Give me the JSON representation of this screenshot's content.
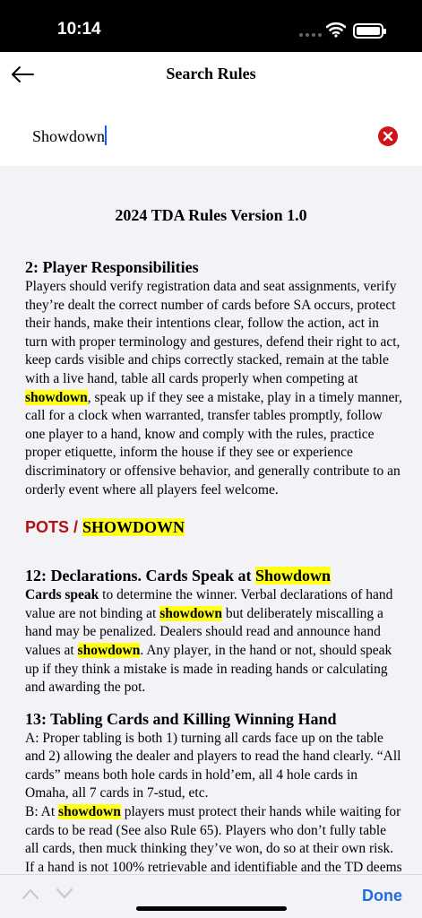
{
  "status_bar": {
    "time": "10:14"
  },
  "nav": {
    "title": "Search Rules"
  },
  "search": {
    "value": "Showdown"
  },
  "document": {
    "title": "2024 TDA Rules Version 1.0",
    "rule2": {
      "heading": "2: Player Responsibilities",
      "text_a": "Players should verify registration data and seat assignments, verify they’re dealt the correct number of cards before SA occurs, protect their hands, make their intentions clear, follow the action, act in turn with proper terminology and gestures, defend their right to act, keep cards visible and chips correctly stacked, remain at the table with a live hand, table all cards properly when competing at ",
      "hl1": "showdown",
      "text_b": ", speak up if they see a mistake, play in a timely manner, call for a clock when warranted, transfer tables promptly, follow one player to a hand, know and comply with the rules, practice proper etiquette, inform the house if they see or experience discriminatory or offensive behavior, and generally contribute to an orderly event where all players feel welcome."
    },
    "category": {
      "prefix": "POTS / ",
      "highlight": "SHOWDOWN"
    },
    "rule12": {
      "heading": "12: Declarations. Cards Speak at ",
      "heading_hl": "Showdown",
      "bold_lead": "Cards speak",
      "text_a": " to determine the winner. Verbal declarations of hand value are not binding at ",
      "hl1": "showdown",
      "text_b": " but deliberately miscalling a hand may be penalized. Dealers should read and announce hand values at ",
      "hl2": "showdown",
      "text_c": ". Any player, in the hand or not, should speak up if they think a mistake is made in reading hands or calculating and awarding the pot."
    },
    "rule13": {
      "heading": "13: Tabling Cards and Killing Winning Hand",
      "para_a": "A: Proper tabling is both 1) turning all cards face up on the table and 2) allowing the dealer and players to read the hand clearly. “All cards” means both hole cards in hold’em, all 4 hole cards in Omaha, all 7 cards in 7-stud, etc.",
      "b_prefix": "B: At ",
      "b_hl": "showdown",
      "b_text": " players must protect their hands while waiting for cards to be read (See also Rule 65). Players who don’t fully table all cards, then muck thinking they’ve won, do so at their own risk. If a hand is not 100% retrievable and identifiable and the TD deems it was not clearly tabled, the player has no claim to the pot."
    }
  },
  "bottom_bar": {
    "done_label": "Done"
  },
  "colors": {
    "highlight": "#ffff1a",
    "category_red": "#b31212",
    "accent": "#1d6fe0",
    "clear_button": "#d0141c"
  }
}
